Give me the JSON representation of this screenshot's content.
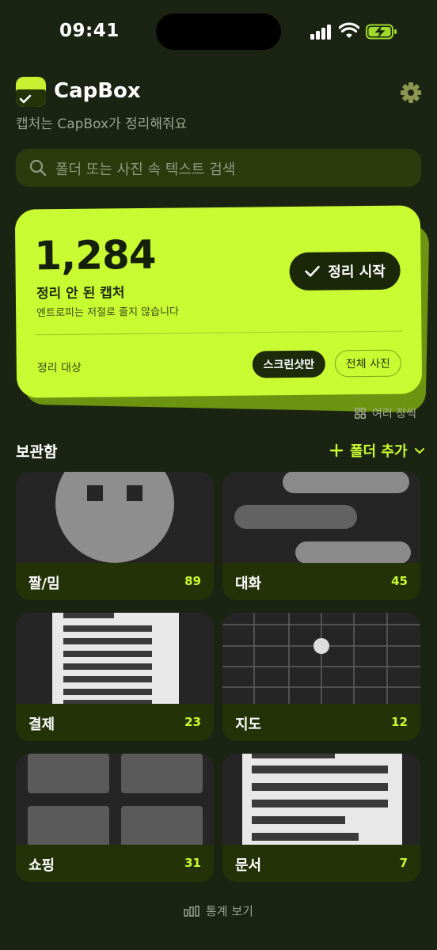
{
  "status_bar": {
    "time": "09:41"
  },
  "header": {
    "app_name": "CapBox",
    "tagline": "캡처는 CapBox가 정리해줘요"
  },
  "search": {
    "placeholder": "폴더 또는 사진 속 텍스트 검색"
  },
  "hero": {
    "count": "1,284",
    "label": "정리 안 된 캡처",
    "sub": "엔트로피는 저절로 줄지 않습니다",
    "start_button": "정리 시작",
    "target_label": "정리 대상",
    "chip_selected": "스크린샷만",
    "chip_other": "전체 사진"
  },
  "multi_label": "여러 장씩",
  "vault": {
    "title": "보관함",
    "add_folder": "폴더 추가"
  },
  "folders": [
    {
      "name": "짤/밈",
      "count": "89"
    },
    {
      "name": "대화",
      "count": "45"
    },
    {
      "name": "결제",
      "count": "23"
    },
    {
      "name": "지도",
      "count": "12"
    },
    {
      "name": "쇼핑",
      "count": "31"
    },
    {
      "name": "문서",
      "count": "7"
    }
  ],
  "footer": {
    "stats_label": "통계 보기"
  },
  "colors": {
    "background": "#1b2412",
    "accent": "#c9fb32",
    "card_footer": "#243307"
  }
}
